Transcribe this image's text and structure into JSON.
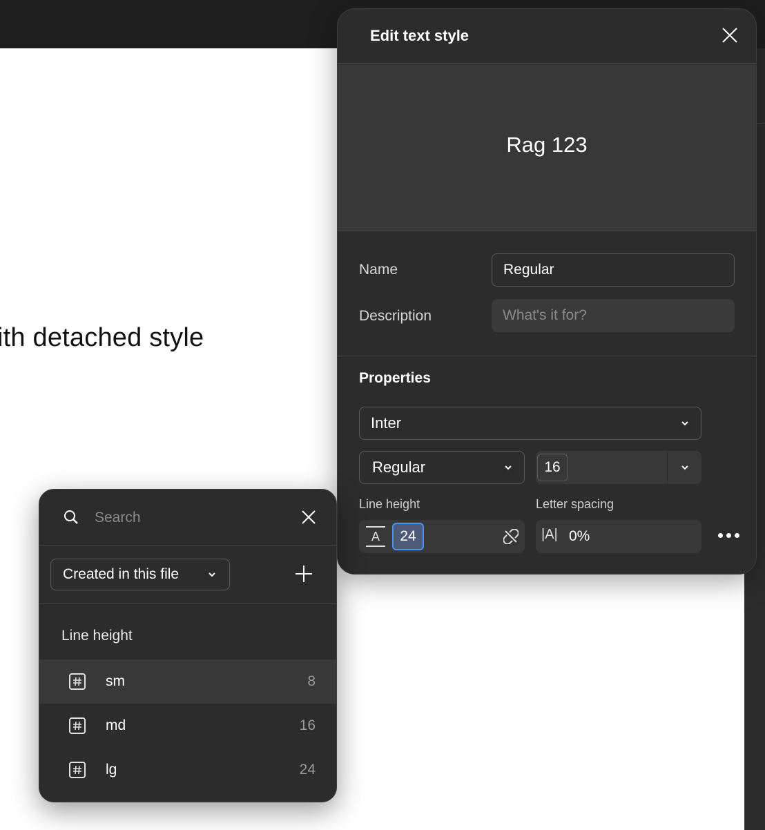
{
  "canvas": {
    "text": "ith detached style"
  },
  "panel": {
    "title": "Edit text style",
    "preview_text": "Rag 123",
    "name_label": "Name",
    "name_value": "Regular",
    "description_label": "Description",
    "description_placeholder": "What's it for?",
    "properties_title": "Properties",
    "font_family": "Inter",
    "font_weight": "Regular",
    "font_size": "16",
    "line_height_label": "Line height",
    "line_height_value": "24",
    "letter_spacing_label": "Letter spacing",
    "letter_spacing_value": "0%"
  },
  "popover": {
    "search_placeholder": "Search",
    "filter_label": "Created in this file",
    "group_title": "Line height",
    "items": [
      {
        "name": "sm",
        "value": "8"
      },
      {
        "name": "md",
        "value": "16"
      },
      {
        "name": "lg",
        "value": "24"
      }
    ]
  },
  "colors": {
    "panel_bg": "#2c2c2c",
    "selected_accent": "#4d8ff5"
  }
}
